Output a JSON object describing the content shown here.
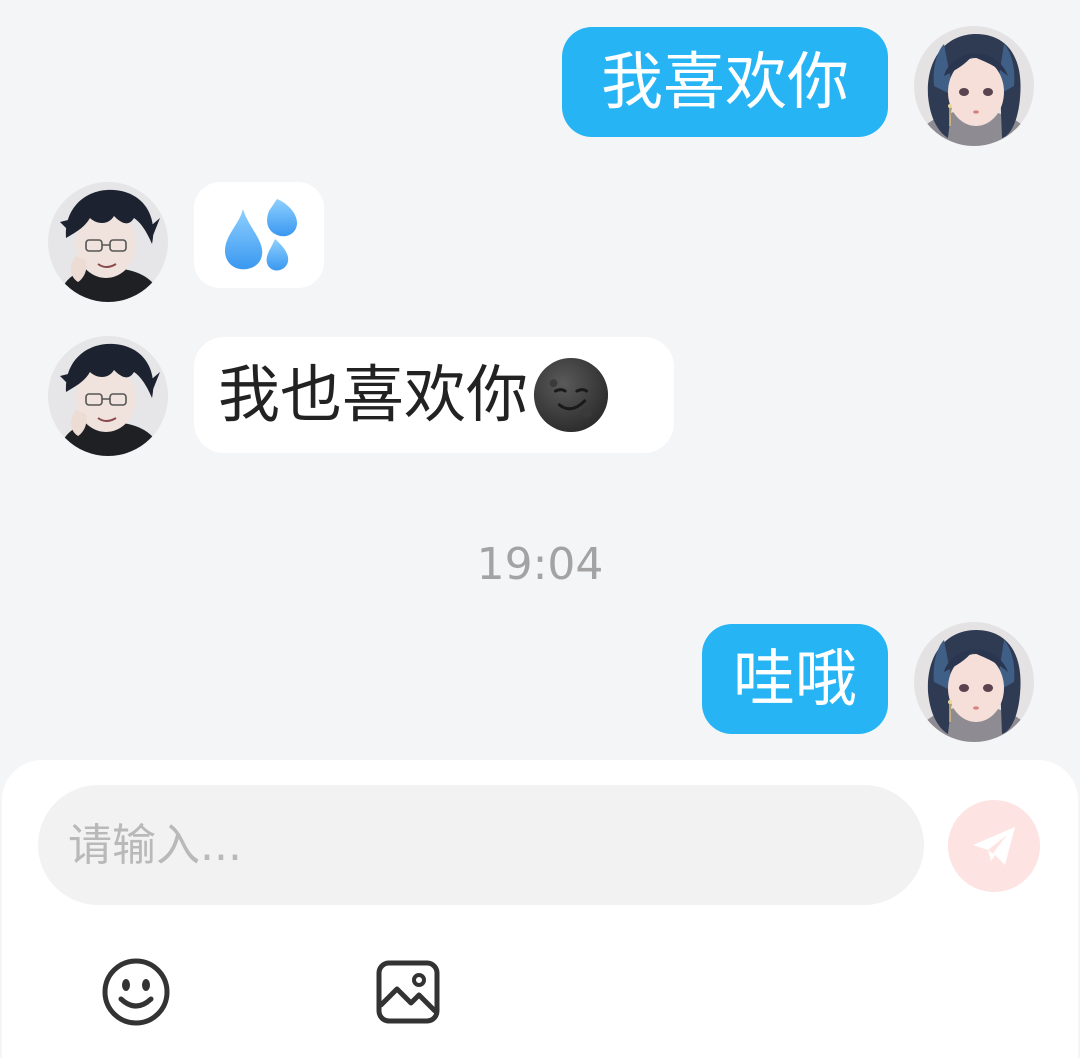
{
  "messages": [
    {
      "direction": "outgoing",
      "text": "我喜欢你",
      "avatar": "girl-avatar"
    },
    {
      "direction": "incoming",
      "emoji": "sweat-droplets-emoji",
      "avatar": "boy-avatar"
    },
    {
      "direction": "incoming",
      "text": "我也喜欢你",
      "emoji": "smirking-new-moon-face-emoji",
      "avatar": "boy-avatar"
    },
    {
      "direction": "outgoing",
      "text": "哇哦",
      "avatar": "girl-avatar"
    }
  ],
  "timestamp": "19:04",
  "composer": {
    "placeholder": "请输入...",
    "value": "",
    "send_icon": "paper-plane-icon",
    "tools": [
      {
        "icon": "smiley-icon"
      },
      {
        "icon": "image-icon"
      }
    ]
  },
  "colors": {
    "background": "#f4f5f7",
    "outgoing_bubble": "#27b4f4",
    "incoming_bubble": "#ffffff",
    "timestamp_text": "#a3a3a3",
    "send_button": "#fde3e1",
    "send_icon": "#ffffff"
  }
}
